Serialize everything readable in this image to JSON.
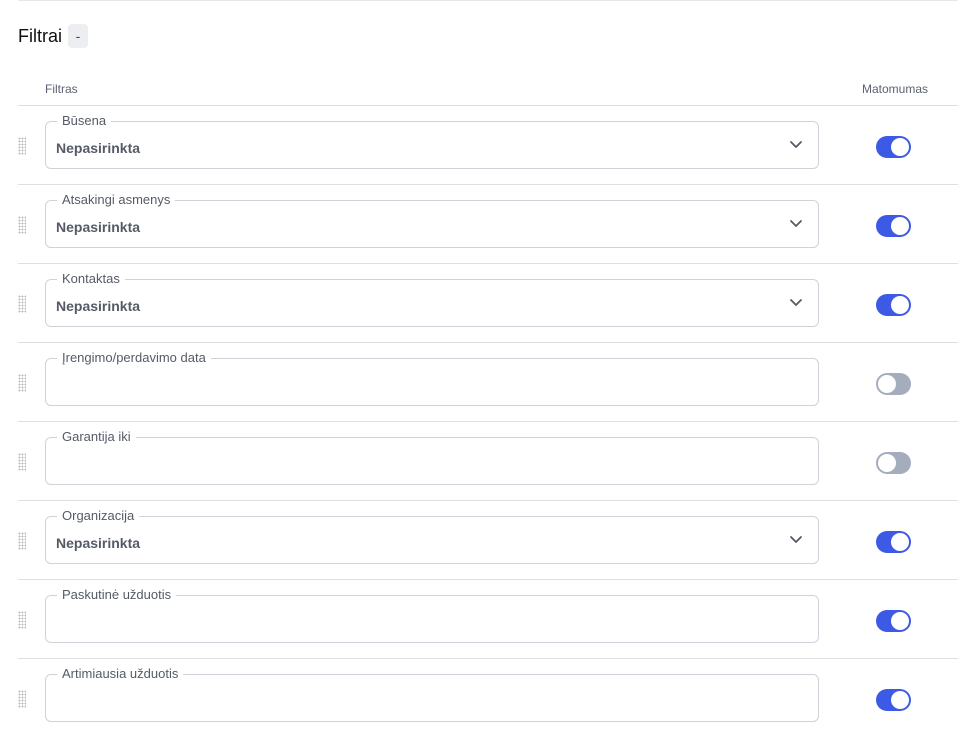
{
  "header": {
    "title": "Filtrai",
    "collapse_label": "-"
  },
  "table": {
    "col_filter": "Filtras",
    "col_visibility": "Matomumas",
    "rows": [
      {
        "label": "Būsena",
        "value": "Nepasirinkta",
        "visible": true
      },
      {
        "label": "Atsakingi asmenys",
        "value": "Nepasirinkta",
        "visible": true
      },
      {
        "label": "Kontaktas",
        "value": "Nepasirinkta",
        "visible": true
      },
      {
        "label": "Įrengimo/perdavimo data",
        "value": "",
        "visible": false
      },
      {
        "label": "Garantija iki",
        "value": "",
        "visible": false
      },
      {
        "label": "Organizacija",
        "value": "Nepasirinkta",
        "visible": true
      },
      {
        "label": "Paskutinė užduotis",
        "value": "",
        "visible": true
      },
      {
        "label": "Artimiausia užduotis",
        "value": "",
        "visible": true
      }
    ]
  },
  "colors": {
    "toggle_on": "#3d5ae6",
    "toggle_off": "#a5adbd"
  },
  "icons": {
    "dropdown": "chevron-down-icon",
    "drag": "drag-handle-icon"
  }
}
